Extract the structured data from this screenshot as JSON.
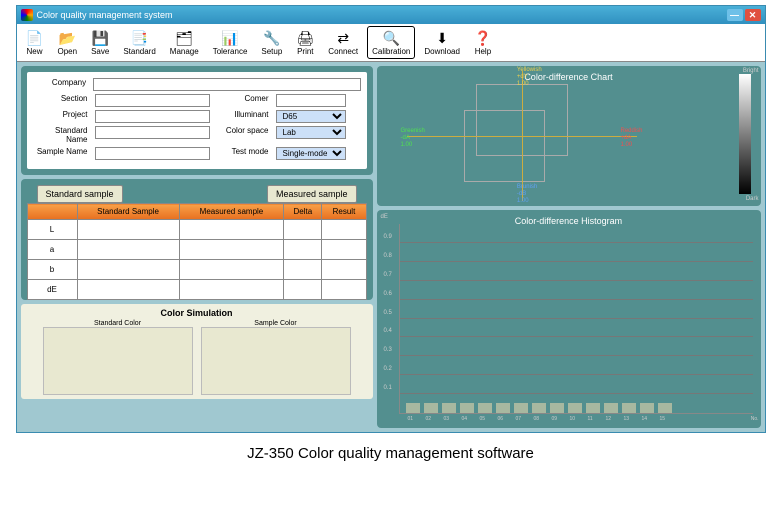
{
  "titlebar": {
    "title": "Color quality management system"
  },
  "toolbar": [
    {
      "label": "New",
      "icon": "📄"
    },
    {
      "label": "Open",
      "icon": "📂"
    },
    {
      "label": "Save",
      "icon": "💾"
    },
    {
      "label": "Standard",
      "icon": "📑"
    },
    {
      "label": "Manage",
      "icon": "🗂"
    },
    {
      "label": "Tolerance",
      "icon": "📊"
    },
    {
      "label": "Setup",
      "icon": "🔧"
    },
    {
      "label": "Print",
      "icon": "🖨"
    },
    {
      "label": "Connect",
      "icon": "⇄"
    },
    {
      "label": "Calibration",
      "icon": "🔍"
    },
    {
      "label": "Download",
      "icon": "⬇"
    },
    {
      "label": "Help",
      "icon": "❓"
    }
  ],
  "form": {
    "company_lbl": "Company",
    "company": "",
    "section_lbl": "Section",
    "section": "",
    "comer_lbl": "Comer",
    "comer": "",
    "project_lbl": "Project",
    "project": "",
    "illuminant_lbl": "Illuminant",
    "illuminant": "D65",
    "stdname_lbl": "Standard Name",
    "stdname": "",
    "colorspace_lbl": "Color space",
    "colorspace": "Lab",
    "samplename_lbl": "Sample Name",
    "samplename": "",
    "testmode_lbl": "Test mode",
    "testmode": "Single-model"
  },
  "tabs": {
    "std": "Standard sample",
    "meas": "Measured sample"
  },
  "table": {
    "headers": [
      "",
      "Standard Sample",
      "Measured sample",
      "Delta",
      "Result"
    ],
    "rows": [
      "L",
      "a",
      "b",
      "dE"
    ]
  },
  "sim": {
    "title": "Color Simulation",
    "std": "Standard Color",
    "samp": "Sample Color"
  },
  "diffchart": {
    "title": "Color-difference Chart",
    "ytop": "Yellowish\n+dY\n1.00",
    "ybot": "Brunish\n-dB\n1.00",
    "xleft": "Greenish\n-dA\n1.00",
    "xright": "Reddish\n+dA\n1.00",
    "bright": "Bright",
    "dark": "Dark"
  },
  "histo": {
    "title": "Color-difference Histogram",
    "de_label": "dE",
    "yticks": [
      "0.9",
      "0.8",
      "0.7",
      "0.6",
      "0.5",
      "0.4",
      "0.3",
      "0.2",
      "0.1"
    ],
    "xticks": [
      "01",
      "02",
      "03",
      "04",
      "05",
      "06",
      "07",
      "08",
      "09",
      "10",
      "11",
      "12",
      "13",
      "14",
      "15"
    ],
    "xend": "No."
  },
  "chart_data": {
    "diff_chart": {
      "type": "scatter",
      "xlabel": "da",
      "ylabel": "db",
      "xlim": [
        -1,
        1
      ],
      "ylim": [
        -1,
        1
      ],
      "series": []
    },
    "histogram": {
      "type": "bar",
      "categories": [
        "01",
        "02",
        "03",
        "04",
        "05",
        "06",
        "07",
        "08",
        "09",
        "10",
        "11",
        "12",
        "13",
        "14",
        "15"
      ],
      "values": [
        0.06,
        0.06,
        0.06,
        0.06,
        0.06,
        0.06,
        0.06,
        0.06,
        0.06,
        0.06,
        0.06,
        0.06,
        0.06,
        0.06,
        0.06
      ],
      "ylabel": "dE",
      "ylim": [
        0,
        0.9
      ]
    }
  },
  "caption": "JZ-350    Color quality management software"
}
